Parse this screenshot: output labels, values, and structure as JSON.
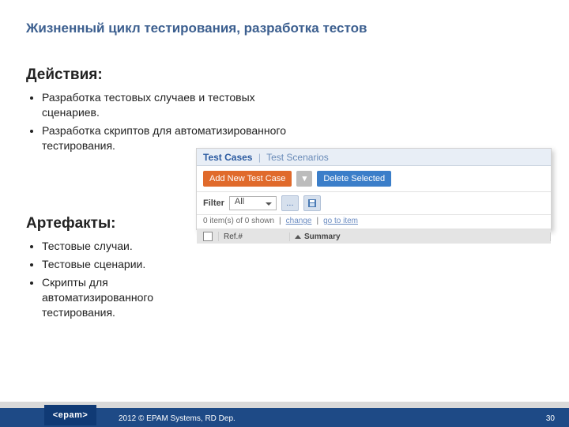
{
  "title": "Жизненный цикл тестирования, разработка тестов",
  "actions": {
    "heading": "Действия:",
    "items": [
      "Разработка тестовых случаев и тестовых сценариев.",
      "Разработка скриптов для автоматизированного тестирования."
    ]
  },
  "artifacts": {
    "heading": "Артефакты:",
    "items": [
      "Тестовые случаи.",
      "Тестовые сценарии.",
      "Скрипты для автоматизированного тестирования."
    ]
  },
  "panel": {
    "tab_active": "Test Cases",
    "tab_sep": "|",
    "tab_inactive": "Test Scenarios",
    "btn_add": "Add New Test Case",
    "btn_delete": "Delete Selected",
    "btn_dots": "…",
    "filter_label": "Filter",
    "filter_value": "All",
    "status": "0 item(s) of 0 shown",
    "status_sep": "|",
    "link_change": "change",
    "link_goto": "go to item",
    "col_ref": "Ref.#",
    "col_summary": "Summary"
  },
  "footer": {
    "badge": "<epam>",
    "text": "2012 © EPAM Systems, RD Dep.",
    "page": "30"
  }
}
